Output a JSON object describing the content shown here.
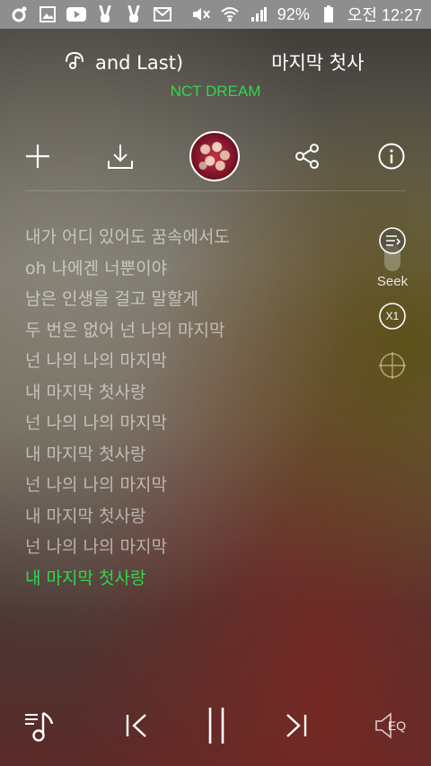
{
  "status_bar": {
    "battery": "92%",
    "time": "오전 12:27",
    "icons_left": [
      "circle-app-icon",
      "gallery-icon",
      "youtube-icon",
      "peace-icon",
      "peace-icon",
      "mail-icon"
    ],
    "icons_right": [
      "mute-icon",
      "wifi-icon",
      "signal-icon",
      "battery-icon"
    ]
  },
  "song": {
    "title_part1": "and Last)",
    "title_part2": "마지막 첫사",
    "artist": "NCT DREAM"
  },
  "actions": [
    "add-icon",
    "download-icon",
    "album-art",
    "share-icon",
    "info-icon"
  ],
  "lyrics": [
    "내가 어디 있어도 꿈속에서도",
    "oh 나에겐 너뿐이야",
    "남은 인생을 걸고 말할게",
    "두 번은 없어 넌 나의 마지막",
    "넌 나의 나의 마지막",
    "내 마지막 첫사랑",
    "넌 나의 나의 마지막",
    "내 마지막 첫사랑",
    "넌 나의 나의 마지막",
    "내 마지막 첫사랑",
    "넌 나의 나의 마지막",
    "내 마지막 첫사랑"
  ],
  "active_lyric_index": 11,
  "side": {
    "seek_label": "Seek",
    "speed_label": "X1"
  },
  "controls": {
    "eq_label": "EQ"
  },
  "colors": {
    "accent": "#2ed84b",
    "statusbar": "#8e8e8e"
  }
}
